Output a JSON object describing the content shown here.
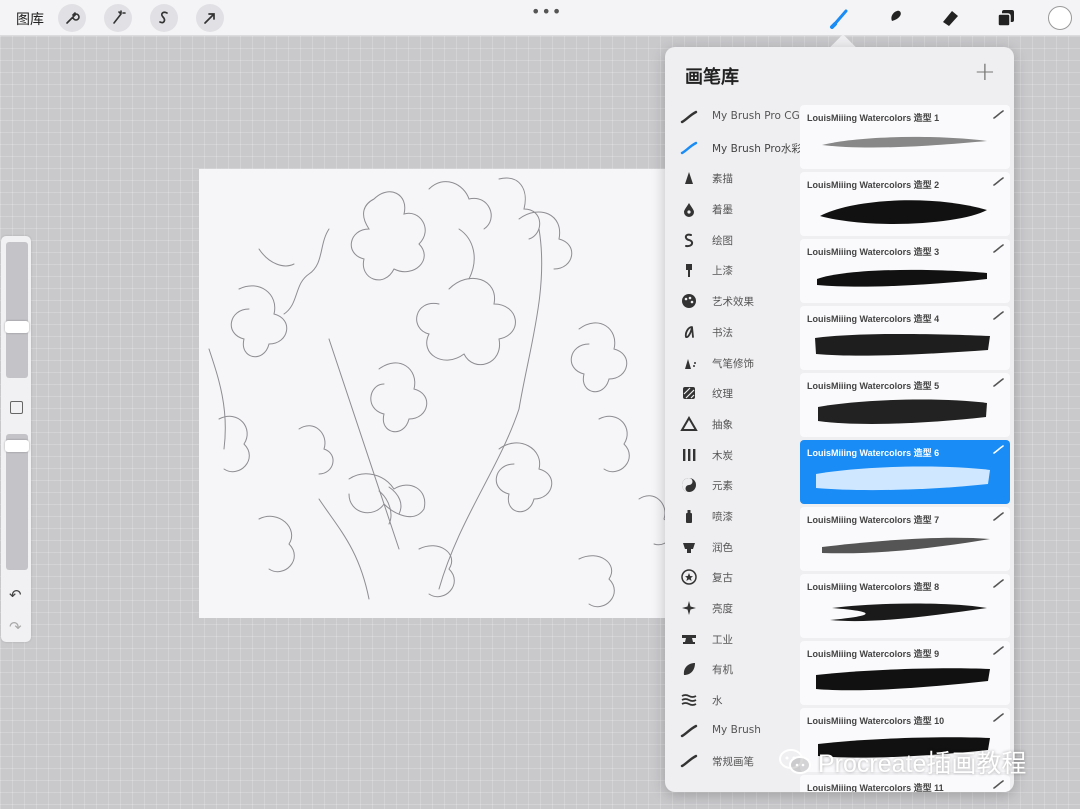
{
  "topbar": {
    "gallery_label": "图库",
    "tools": [
      "wrench-icon",
      "magic-wand-icon",
      "selection-icon",
      "transform-icon"
    ],
    "more_dots": "•••",
    "right_tools": [
      "brush-icon",
      "smudge-icon",
      "eraser-icon",
      "layers-icon"
    ],
    "active_tool": "brush",
    "accent_color": "#1a8cf5",
    "current_color": "#ffffff"
  },
  "sidebar": {
    "size_slider_level": 0.36,
    "opacity_slider_level": 0.05,
    "undo_icon": "↶",
    "redo_icon": "↷"
  },
  "library": {
    "title": "画笔库",
    "add_icon": "+",
    "sets": [
      {
        "label": "My Brush Pro CG",
        "icon": "stroke-icon"
      },
      {
        "label": "My Brush Pro水彩",
        "icon": "stroke-icon",
        "active": true
      },
      {
        "label": "素描",
        "icon": "pencil-tip-icon"
      },
      {
        "label": "着墨",
        "icon": "ink-drop-icon"
      },
      {
        "label": "绘图",
        "icon": "squiggle-icon"
      },
      {
        "label": "上漆",
        "icon": "paint-brush-icon"
      },
      {
        "label": "艺术效果",
        "icon": "palette-icon"
      },
      {
        "label": "书法",
        "icon": "calligraphy-icon"
      },
      {
        "label": "气笔修饰",
        "icon": "airbrush-icon"
      },
      {
        "label": "纹理",
        "icon": "texture-icon"
      },
      {
        "label": "抽象",
        "icon": "triangle-icon"
      },
      {
        "label": "木炭",
        "icon": "charcoal-icon"
      },
      {
        "label": "元素",
        "icon": "yin-yang-icon"
      },
      {
        "label": "喷漆",
        "icon": "spray-can-icon"
      },
      {
        "label": "润色",
        "icon": "touchup-icon"
      },
      {
        "label": "复古",
        "icon": "star-badge-icon"
      },
      {
        "label": "亮度",
        "icon": "sparkle-icon"
      },
      {
        "label": "工业",
        "icon": "anvil-icon"
      },
      {
        "label": "有机",
        "icon": "leaf-icon"
      },
      {
        "label": "水",
        "icon": "waves-icon"
      },
      {
        "label": "My Brush",
        "icon": "stroke-icon"
      },
      {
        "label": "常规画笔",
        "icon": "stroke-icon"
      }
    ],
    "brushes": [
      {
        "name": "LouisMiiing Watercolors 造型 1"
      },
      {
        "name": "LouisMiiing Watercolors 造型 2"
      },
      {
        "name": "LouisMiiing Watercolors 造型 3"
      },
      {
        "name": "LouisMiiing Watercolors 造型 4"
      },
      {
        "name": "LouisMiiing Watercolors 造型 5"
      },
      {
        "name": "LouisMiiing Watercolors 造型 6",
        "selected": true
      },
      {
        "name": "LouisMiiing Watercolors 造型 7"
      },
      {
        "name": "LouisMiiing Watercolors 造型 8"
      },
      {
        "name": "LouisMiiing Watercolors 造型 9"
      },
      {
        "name": "LouisMiiing Watercolors 造型 10"
      },
      {
        "name": "LouisMiiing Watercolors 造型 11"
      }
    ]
  },
  "watermark": {
    "text": "Procreate插画教程",
    "icon": "wechat-icon"
  }
}
